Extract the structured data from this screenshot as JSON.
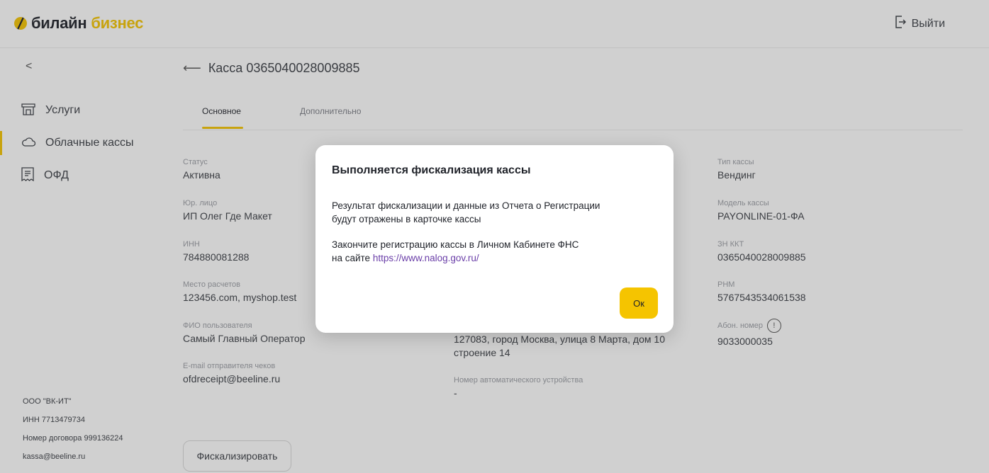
{
  "header": {
    "logo_a": "билайн",
    "logo_b": "бизнес",
    "logout_label": "Выйти"
  },
  "sidebar": {
    "collapse_glyph": "<",
    "items": [
      {
        "label": "Услуги",
        "icon": "store-icon"
      },
      {
        "label": "Облачные кассы",
        "icon": "cloud-icon",
        "active": true
      },
      {
        "label": "ОФД",
        "icon": "document-icon"
      }
    ],
    "company": {
      "name": "ООО \"ВК-ИТ\"",
      "inn": "ИНН 7713479734",
      "contract": "Номер договора 999136224",
      "email": "kassa@beeline.ru"
    }
  },
  "page": {
    "back_glyph": "⟵",
    "title": "Касса 0365040028009885",
    "tabs": [
      "Основное",
      "Дополнительно"
    ]
  },
  "fields": {
    "status": {
      "label": "Статус",
      "value": "Активна"
    },
    "legal": {
      "label": "Юр. лицо",
      "value": "ИП Олег Где Макет"
    },
    "inn": {
      "label": "ИНН",
      "value": "784880081288"
    },
    "place": {
      "label": "Место расчетов",
      "value": "123456.com, myshop.test"
    },
    "user": {
      "label": "ФИО пользователя",
      "value": "Самый Главный Оператор"
    },
    "email": {
      "label": "E-mail отправителя чеков",
      "value": "ofdreceipt@beeline.ru"
    },
    "address": {
      "value": "127083, город Москва, улица 8 Марта, дом 10 строение 14"
    },
    "device": {
      "label": "Номер автоматического устройства",
      "value": "-"
    },
    "type": {
      "label": "Тип кассы",
      "value": "Вендинг"
    },
    "model": {
      "label": "Модель кассы",
      "value": "PAYONLINE-01-ФА"
    },
    "serial": {
      "label": "ЗН ККТ",
      "value": "0365040028009885"
    },
    "rnm": {
      "label": "РНМ",
      "value": "5767543534061538"
    },
    "subscriber": {
      "label": "Абон. номер",
      "info_glyph": "!",
      "value": "9033000035"
    }
  },
  "actions": {
    "fiscalize_label": "Фискализировать"
  },
  "modal": {
    "title": "Выполняется фискализация кассы",
    "p1_line1": "Результат фискализации и данные из Отчета о Регистрации",
    "p1_line2": "будут отражены в карточке кассы",
    "p2_line1": "Закончите регистрацию кассы в Личном Кабинете ФНС",
    "p2_prefix": "на сайте",
    "link": "https://www.nalog.gov.ru/",
    "ok_label": "Ок"
  },
  "colors": {
    "accent": "#f5c400",
    "link": "#6a3ea8",
    "overlay": "rgba(60,60,58,0.24)"
  }
}
